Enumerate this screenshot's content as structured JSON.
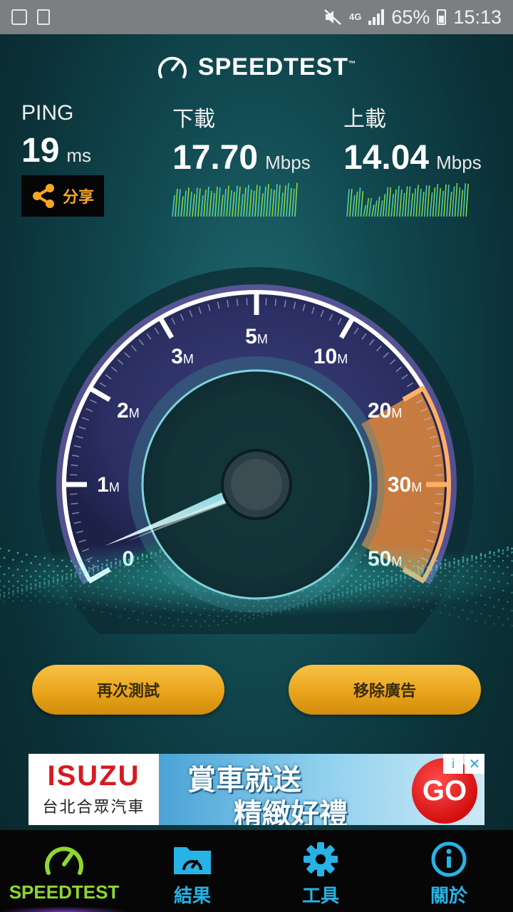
{
  "status_bar": {
    "network": "4G",
    "battery": "65%",
    "time": "15:13"
  },
  "header": {
    "title": "SPEEDTEST",
    "trademark": "™"
  },
  "ping": {
    "label": "PING",
    "value": "19",
    "unit": "ms"
  },
  "download": {
    "label": "下載",
    "value": "17.70",
    "unit": "Mbps"
  },
  "upload": {
    "label": "上載",
    "value": "14.04",
    "unit": "Mbps"
  },
  "share_label": "分享",
  "gauge": {
    "ticks": [
      {
        "num": "0",
        "unit": ""
      },
      {
        "num": "1",
        "unit": "M"
      },
      {
        "num": "2",
        "unit": "M"
      },
      {
        "num": "3",
        "unit": "M"
      },
      {
        "num": "5",
        "unit": "M"
      },
      {
        "num": "10",
        "unit": "M"
      },
      {
        "num": "20",
        "unit": "M"
      },
      {
        "num": "30",
        "unit": "M"
      },
      {
        "num": "50",
        "unit": "M"
      }
    ],
    "needle_value_mbps": 0
  },
  "buttons": {
    "retest": "再次測試",
    "remove_ads": "移除廣告"
  },
  "ad": {
    "brand": "ISUZU",
    "dealer": "台北合眾汽車",
    "line1": "賞車就送",
    "line2": "精緻好禮",
    "cta": "GO",
    "info_symbol": "i",
    "close_symbol": "✕"
  },
  "nav": {
    "items": [
      {
        "label": "SPEEDTEST",
        "icon": "speedometer-icon",
        "active": true
      },
      {
        "label": "結果",
        "icon": "results-folder-icon",
        "active": false
      },
      {
        "label": "工具",
        "icon": "gear-icon",
        "active": false
      },
      {
        "label": "關於",
        "icon": "info-icon",
        "active": false
      }
    ]
  },
  "colors": {
    "accent_orange": "#f5a623",
    "nav_blue": "#27b3e6",
    "nav_active_green": "#8fd630",
    "graph_green": "#8fd630"
  }
}
